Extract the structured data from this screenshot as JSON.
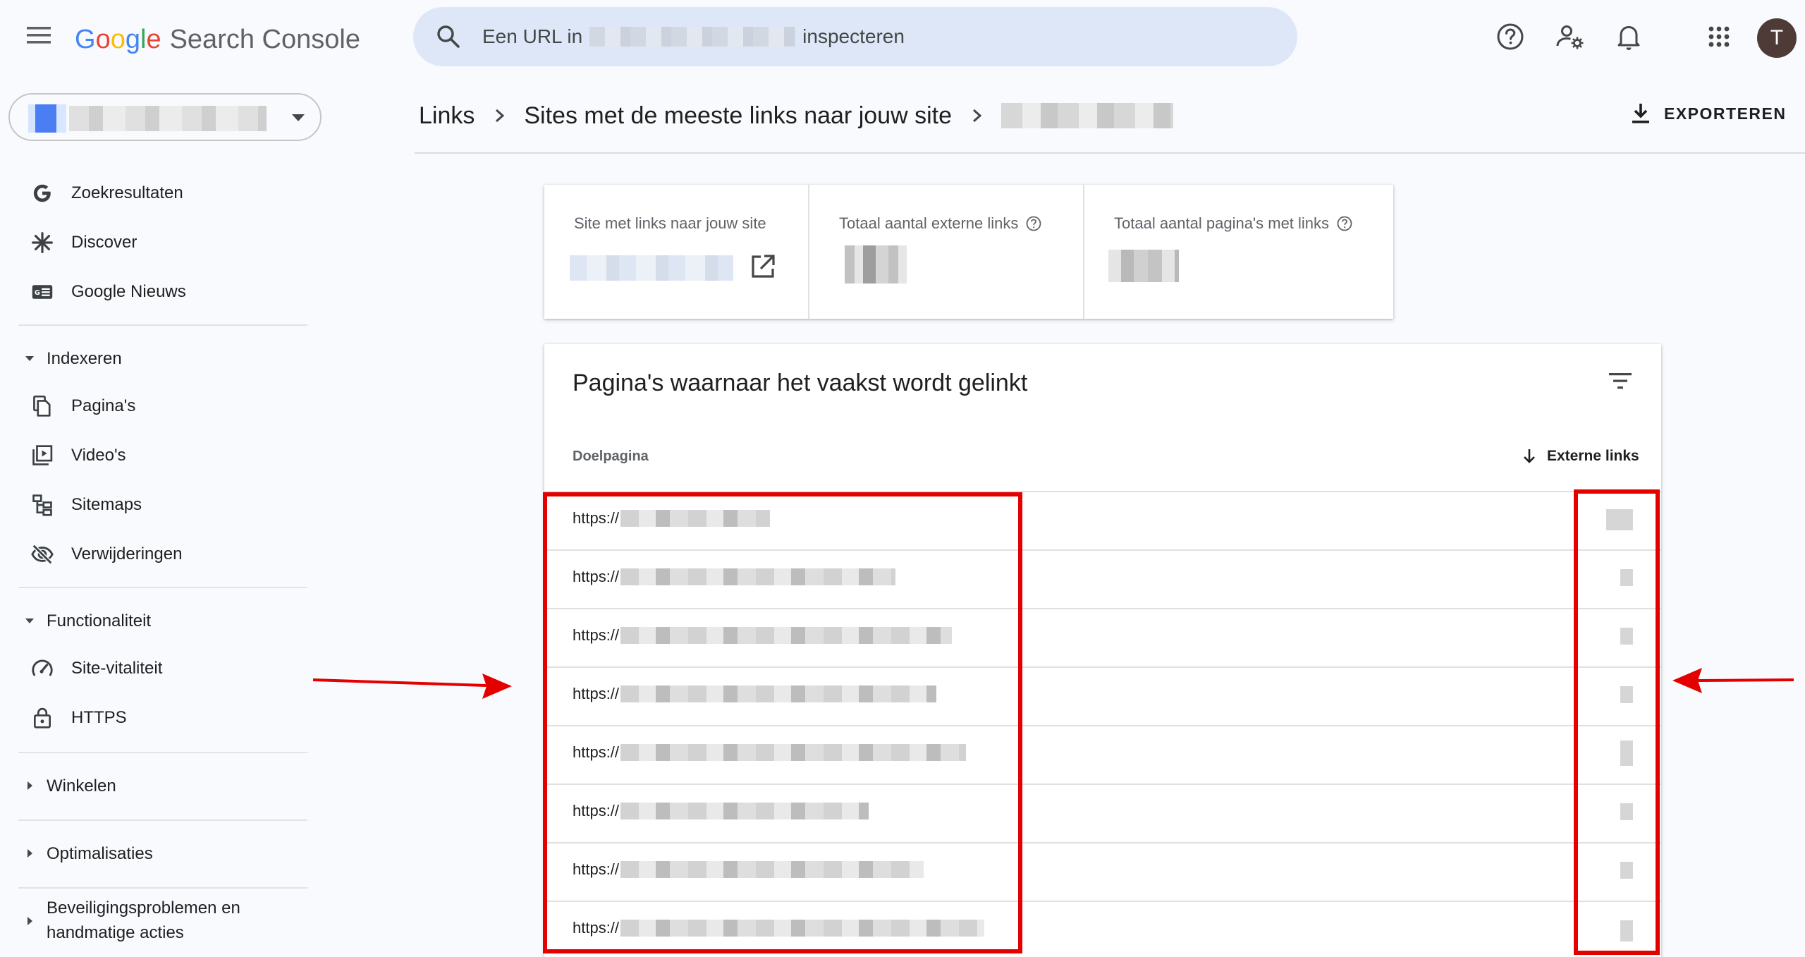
{
  "header": {
    "logo": {
      "g1": "G",
      "g2": "o",
      "g3": "o",
      "g4": "g",
      "g5": "l",
      "g6": "e",
      "product": "Search Console"
    },
    "search": {
      "prefix": "Een URL in",
      "suffix": "inspecteren"
    },
    "avatar_letter": "T",
    "icons": [
      "menu-icon",
      "search-icon",
      "help-icon",
      "manage-users-icon",
      "notifications-icon",
      "apps-icon"
    ]
  },
  "sidebar": {
    "top_items": [
      {
        "label": "Zoekresultaten",
        "icon": "google-g-icon"
      },
      {
        "label": "Discover",
        "icon": "asterisk-icon"
      },
      {
        "label": "Google Nieuws",
        "icon": "google-news-icon"
      }
    ],
    "sections": [
      {
        "label": "Indexeren",
        "expanded": true,
        "items": [
          {
            "label": "Pagina's",
            "icon": "pages-icon"
          },
          {
            "label": "Video's",
            "icon": "video-icon"
          },
          {
            "label": "Sitemaps",
            "icon": "sitemap-icon"
          },
          {
            "label": "Verwijderingen",
            "icon": "visibility-off-icon"
          }
        ]
      },
      {
        "label": "Functionaliteit",
        "expanded": true,
        "items": [
          {
            "label": "Site-vitaliteit",
            "icon": "speed-icon"
          },
          {
            "label": "HTTPS",
            "icon": "lock-icon"
          }
        ]
      },
      {
        "label": "Winkelen",
        "expanded": false
      },
      {
        "label": "Optimalisaties",
        "expanded": false
      },
      {
        "label": "Beveiligingsproblemen en handmatige acties",
        "line1": "Beveiligingsproblemen en",
        "line2": "handmatige acties",
        "expanded": false
      }
    ]
  },
  "breadcrumb": {
    "items": [
      "Links",
      "Sites met de meeste links naar jouw site"
    ]
  },
  "export_label": "EXPORTEREN",
  "cards": [
    {
      "title": "Site met links naar jouw site"
    },
    {
      "title": "Totaal aantal externe links"
    },
    {
      "title": "Totaal aantal pagina's met links"
    }
  ],
  "table": {
    "title": "Pagina's waarnaar het vaakst wordt gelinkt",
    "col_target": "Doelpagina",
    "col_links": "Externe links",
    "rows": [
      "https://",
      "https://",
      "https://",
      "https://",
      "https://",
      "https://",
      "https://",
      "https://"
    ]
  },
  "colors": {
    "accent": "#1a73e8",
    "annotation": "#e50000",
    "search_bg": "#dde7f8"
  }
}
